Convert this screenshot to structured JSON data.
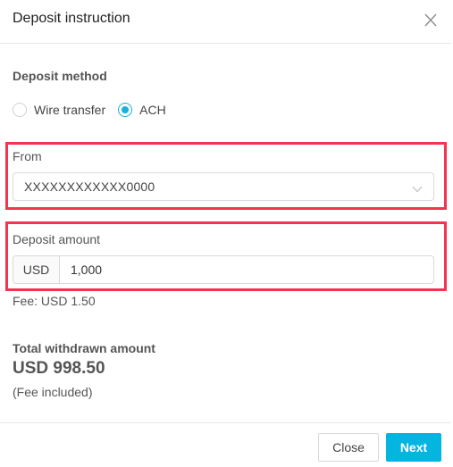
{
  "header": {
    "title": "Deposit instruction",
    "close_icon": "close-icon"
  },
  "deposit_method": {
    "label": "Deposit method",
    "options": [
      {
        "label": "Wire transfer",
        "selected": false
      },
      {
        "label": "ACH",
        "selected": true
      }
    ]
  },
  "from": {
    "label": "From",
    "value": "XXXXXXXXXXXX0000",
    "icon": "chevron-down-icon"
  },
  "deposit_amount": {
    "label": "Deposit amount",
    "currency": "USD",
    "value": "1,000"
  },
  "fee": {
    "text": "Fee: USD 1.50"
  },
  "total": {
    "label": "Total withdrawn amount",
    "value": "USD 998.50",
    "note": "(Fee included)"
  },
  "footer": {
    "close_label": "Close",
    "next_label": "Next"
  },
  "colors": {
    "accent": "#03b5df",
    "highlight": "#f5334f"
  }
}
